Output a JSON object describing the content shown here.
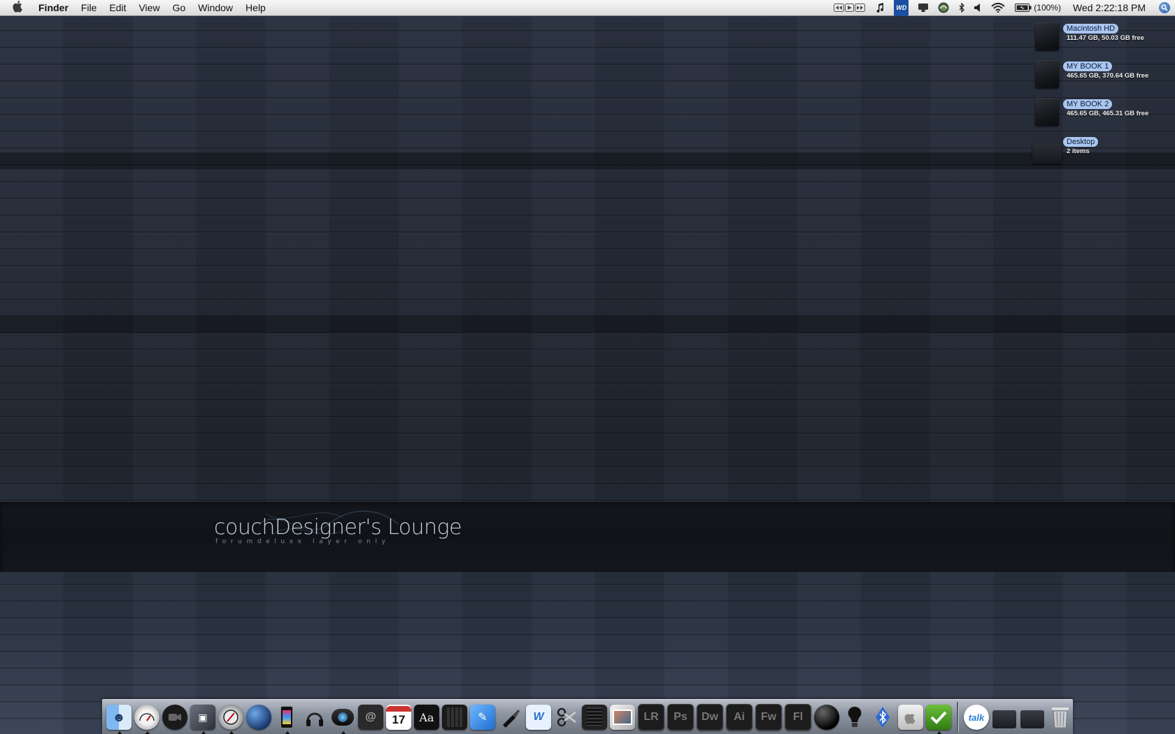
{
  "menubar": {
    "app_name": "Finder",
    "menus": [
      "File",
      "Edit",
      "View",
      "Go",
      "Window",
      "Help"
    ],
    "status": {
      "battery_text": "(100%)",
      "clock": "Wed 2:22:18 PM",
      "wd_label": "WD"
    }
  },
  "desktop": {
    "wallpaper": {
      "title": "couchDesigner's Lounge",
      "subtitle": "forumdeluxx layer only"
    },
    "icons": [
      {
        "name": "Macintosh HD",
        "info": "111.47 GB, 50.03 GB free",
        "kind": "drive"
      },
      {
        "name": "MY BOOK 1",
        "info": "465.65 GB, 370.64 GB free",
        "kind": "drive"
      },
      {
        "name": "MY BOOK 2",
        "info": "465.65 GB, 465.31 GB free",
        "kind": "drive"
      },
      {
        "name": "Desktop",
        "info": "2 items",
        "kind": "folder"
      }
    ]
  },
  "dock": {
    "apps": [
      {
        "icon": "finder-icon",
        "running": true
      },
      {
        "icon": "dashboard-icon",
        "running": true
      },
      {
        "icon": "ichat-icon",
        "running": false
      },
      {
        "icon": "preview-icon",
        "running": true
      },
      {
        "icon": "safari-icon",
        "running": true
      },
      {
        "icon": "network-globe-icon",
        "running": false
      },
      {
        "icon": "iphone-icon",
        "running": true
      },
      {
        "icon": "headphones-icon",
        "running": false
      },
      {
        "icon": "camera-lens-icon",
        "running": true
      },
      {
        "icon": "address-book-icon",
        "running": false
      },
      {
        "icon": "ical-icon",
        "label": "17",
        "running": false
      },
      {
        "icon": "dictionary-icon",
        "label": "Aa",
        "running": false
      },
      {
        "icon": "calculator-icon",
        "running": false
      },
      {
        "icon": "textedit-icon",
        "running": false
      },
      {
        "icon": "ink-pen-icon",
        "running": false
      },
      {
        "icon": "word-icon",
        "running": false
      },
      {
        "icon": "scissors-icon",
        "running": false
      },
      {
        "icon": "notes-icon",
        "running": false
      },
      {
        "icon": "photo-browser-icon",
        "running": false
      },
      {
        "icon": "lightroom-icon",
        "label": "LR",
        "running": false
      },
      {
        "icon": "photoshop-icon",
        "label": "Ps",
        "running": false
      },
      {
        "icon": "dreamweaver-icon",
        "label": "Dw",
        "running": false
      },
      {
        "icon": "illustrator-icon",
        "label": "Ai",
        "running": false
      },
      {
        "icon": "fireworks-icon",
        "label": "Fw",
        "running": false
      },
      {
        "icon": "flash-icon",
        "label": "Fl",
        "running": false
      },
      {
        "icon": "black-orb-icon",
        "running": false
      },
      {
        "icon": "lightbulb-icon",
        "running": false
      },
      {
        "icon": "bluetooth-icon",
        "running": false
      },
      {
        "icon": "system-info-icon",
        "running": false
      },
      {
        "icon": "checkmark-icon",
        "running": true
      }
    ],
    "docs": [
      {
        "icon": "google-talk-icon",
        "label": "talk"
      },
      {
        "icon": "folder-stack-icon"
      },
      {
        "icon": "folder-stack-icon"
      },
      {
        "icon": "trash-icon"
      }
    ]
  }
}
